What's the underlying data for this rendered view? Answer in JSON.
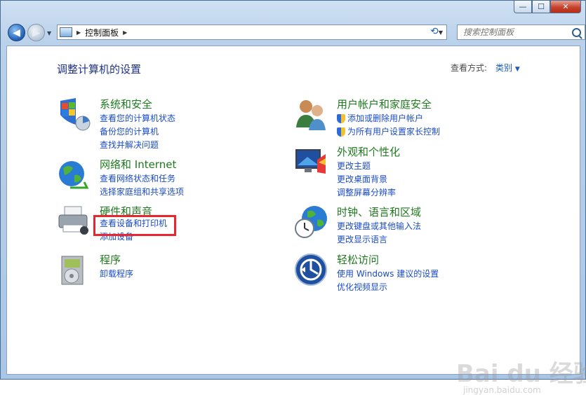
{
  "window": {
    "minimize": "—",
    "maximize": "☐",
    "close": "✕"
  },
  "address": {
    "breadcrumb": "控制面板"
  },
  "search": {
    "placeholder": "搜索控制面板"
  },
  "page": {
    "title": "调整计算机的设置",
    "view_by_label": "查看方式:",
    "view_by_value": "类别"
  },
  "categories": [
    {
      "title": "系统和安全",
      "links": [
        "查看您的计算机状态",
        "备份您的计算机",
        "查找并解决问题"
      ],
      "icon": "system-security-icon"
    },
    {
      "title": "网络和 Internet",
      "links": [
        "查看网络状态和任务",
        "选择家庭组和共享选项"
      ],
      "icon": "network-icon"
    },
    {
      "title": "硬件和声音",
      "links": [
        "查看设备和打印机",
        "添加设备"
      ],
      "icon": "hardware-sound-icon"
    },
    {
      "title": "程序",
      "links": [
        "卸载程序"
      ],
      "icon": "programs-icon"
    },
    {
      "title": "用户帐户和家庭安全",
      "links": [
        "添加或删除用户帐户",
        "为所有用户设置家长控制"
      ],
      "icon": "user-accounts-icon"
    },
    {
      "title": "外观和个性化",
      "links": [
        "更改主题",
        "更改桌面背景",
        "调整屏幕分辨率"
      ],
      "icon": "appearance-icon"
    },
    {
      "title": "时钟、语言和区域",
      "links": [
        "更改键盘或其他输入法",
        "更改显示语言"
      ],
      "icon": "clock-language-icon"
    },
    {
      "title": "轻松访问",
      "links": [
        "使用 Windows 建议的设置",
        "优化视频显示"
      ],
      "icon": "ease-of-access-icon"
    }
  ],
  "watermark": {
    "brand": "Bai du 经验",
    "url": "jingyan.baidu.com"
  },
  "colors": {
    "title": "#1e3287",
    "category": "#1f7a1f",
    "link": "#1a4bc8",
    "highlight": "#e8262f"
  }
}
